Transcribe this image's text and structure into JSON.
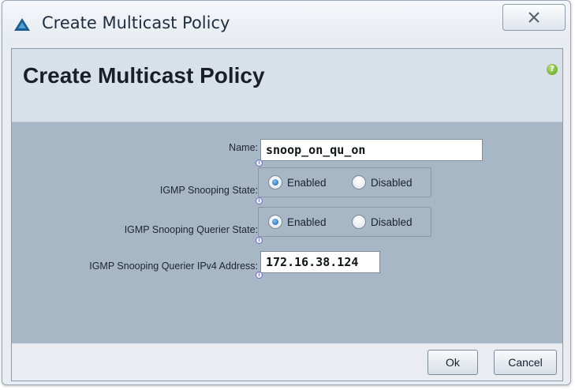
{
  "window": {
    "title": "Create Multicast Policy"
  },
  "header": {
    "title": "Create Multicast Policy"
  },
  "form": {
    "name_label": "Name:",
    "name_value": "snoop_on_qu_on",
    "igmp_snooping_state_label": "IGMP Snooping State:",
    "igmp_snooping_state_options": [
      "Enabled",
      "Disabled"
    ],
    "igmp_snooping_state_selected": "Enabled",
    "querier_state_label": "IGMP Snooping Querier State:",
    "querier_state_options": [
      "Enabled",
      "Disabled"
    ],
    "querier_state_selected": "Enabled",
    "querier_ipv4_label": "IGMP Snooping Querier IPv4 Address:",
    "querier_ipv4_value": "172.16.38.124"
  },
  "footer": {
    "ok_label": "Ok",
    "cancel_label": "Cancel"
  },
  "icons": {
    "app": "triangle-logo-icon",
    "close": "close-icon",
    "help": "help-icon",
    "info": "info-icon"
  },
  "colors": {
    "header_band": "#d8e1ea",
    "form_area": "#a8b7c6",
    "radio_selected": "#1f5fa8",
    "help_icon": "#5b9c1b"
  }
}
